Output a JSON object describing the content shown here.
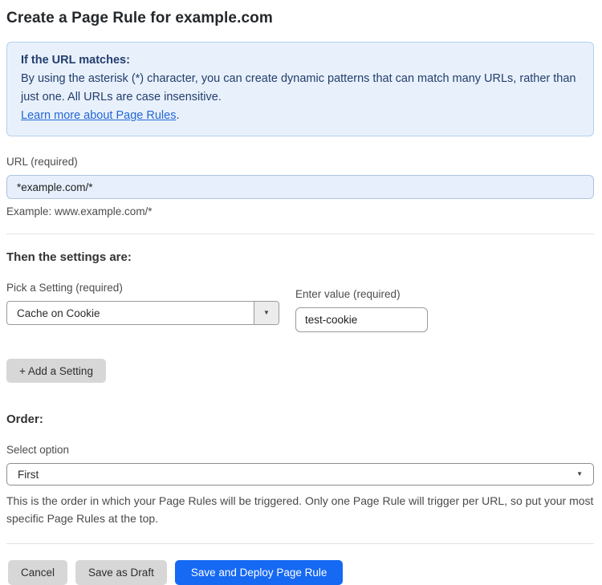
{
  "page": {
    "title": "Create a Page Rule for example.com"
  },
  "info_box": {
    "heading": "If the URL matches:",
    "body": "By using the asterisk (*) character, you can create dynamic patterns that can match many URLs, rather than just one. All URLs are case insensitive.",
    "link_label": "Learn more about Page Rules",
    "link_suffix": "."
  },
  "url_section": {
    "label": "URL (required)",
    "value": "*example.com/*",
    "example": "Example: www.example.com/*"
  },
  "settings_section": {
    "heading": "Then the settings are:",
    "setting_label": "Pick a Setting (required)",
    "setting_value": "Cache on Cookie",
    "dropdown_caret": "▼",
    "value_label": "Enter value (required)",
    "value_value": "test-cookie",
    "add_setting_label": "+ Add a Setting"
  },
  "order_section": {
    "heading": "Order:",
    "select_label": "Select option",
    "selected_option": "First",
    "select_caret": "▼",
    "help_text": "This is the order in which your Page Rules will be triggered. Only one Page Rule will trigger per URL, so put your most specific Page Rules at the top."
  },
  "actions": {
    "cancel_label": "Cancel",
    "save_draft_label": "Save as Draft",
    "save_deploy_label": "Save and Deploy Page Rule"
  },
  "colors": {
    "accent_blue": "#1669f2",
    "info_bg": "#e8f1fb",
    "info_border": "#b3d1ef",
    "info_text": "#233d6d",
    "link_blue": "#2467d6",
    "url_input_bg": "#e7effc"
  }
}
